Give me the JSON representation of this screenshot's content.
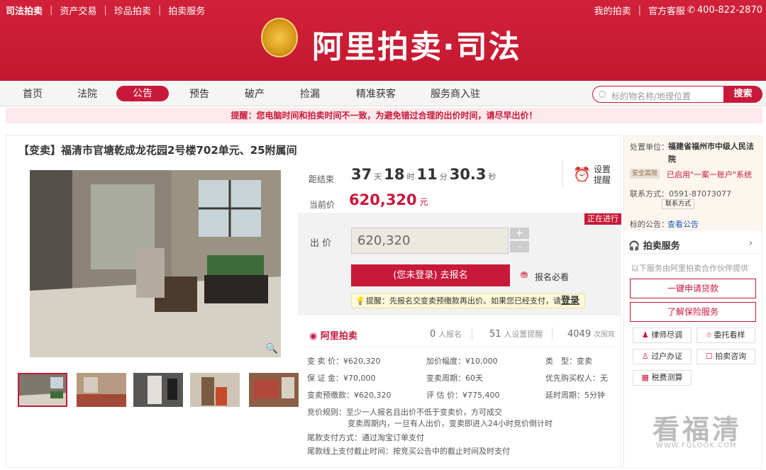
{
  "top": {
    "brand": "司法拍卖",
    "links": [
      "资产交易",
      "珍品拍卖",
      "拍卖服务"
    ],
    "my": "我的拍卖",
    "service": "官方客服",
    "phone": "400-822-2870"
  },
  "logo": {
    "title": "阿里拍卖·司法"
  },
  "nav": {
    "items": [
      "首页",
      "法院",
      "公告",
      "预告",
      "破产",
      "捡漏",
      "精准获客",
      "服务商入驻"
    ],
    "search_placeholder": "标的物名称/地理位置",
    "search_label": "搜索"
  },
  "reminder": "提醒：您电脑时间和拍卖时间不一致，为避免错过合理的出价时间，请尽早出价！",
  "item": {
    "title": "【变卖】福清市官塘乾成龙花园2号楼702单元、25附属间"
  },
  "countdown": {
    "label": "距结束",
    "days": "37",
    "d": "天",
    "hours": "18",
    "h": "时",
    "mins": "11",
    "m": "分",
    "secs": "30.3",
    "s": "秒",
    "remind": "设置提醒"
  },
  "price": {
    "label": "当前价",
    "value": "620,320",
    "unit": "元",
    "status": "正在进行"
  },
  "bid": {
    "label": "出 价",
    "value": "620,320",
    "plus": "+",
    "minus": "-",
    "signup": "(您未登录) 去报名",
    "notice": "报名必看",
    "tip": "提醒：先报名交变卖预缴款再出价。如果您已经支付，请",
    "login": "登录"
  },
  "stats": {
    "brand": "阿里拍卖",
    "signups": "0",
    "signups_label": "人报名",
    "reminders": "51",
    "reminders_label": "人设置提醒",
    "views": "4049",
    "views_label": "次围观"
  },
  "details": [
    [
      "变 卖 价：¥620,320",
      "加价幅度：¥10,000",
      "类　型：变卖"
    ],
    [
      "保 证 金：¥70,000",
      "变卖周期：60天",
      "优先购买权人：无"
    ],
    [
      "变卖预缴款：¥620,320",
      "评 估 价：¥775,400",
      "延时周期：5分钟"
    ]
  ],
  "rules": {
    "l1": "竞价规则：至少一人报名且出价不低于变卖价，方可成交",
    "l2": "变卖周期内，一旦有人出价，变卖即进入24小时竞价倒计时",
    "l3": "尾款支付方式：通过淘宝订单支付",
    "l4": "尾款线上支付截止时间：按竞买公告中的截止时间及时支付"
  },
  "court": {
    "label": "处置单位：",
    "name": "福建省福州市中级人民法院",
    "badge": "安全高效",
    "system": "已启用\"一案一账户\"系统",
    "contact": "联系方式：0591-87073077",
    "contact_btn": "联系方式",
    "notice_label": "标的公告：",
    "notice_link": "查看公告"
  },
  "services": {
    "title": "拍卖服务",
    "sub": "以下服务由阿里拍卖合作伙伴提供",
    "loan": "一键申请贷款",
    "insurance": "了解保险服务",
    "lawyer": "律师尽调",
    "visit": "委托看样",
    "transfer": "过户办证",
    "consult": "拍卖咨询",
    "tax": "税费测算"
  },
  "watermark": {
    "text": "看福清",
    "url": "WWW.FQLOOK.COM"
  }
}
